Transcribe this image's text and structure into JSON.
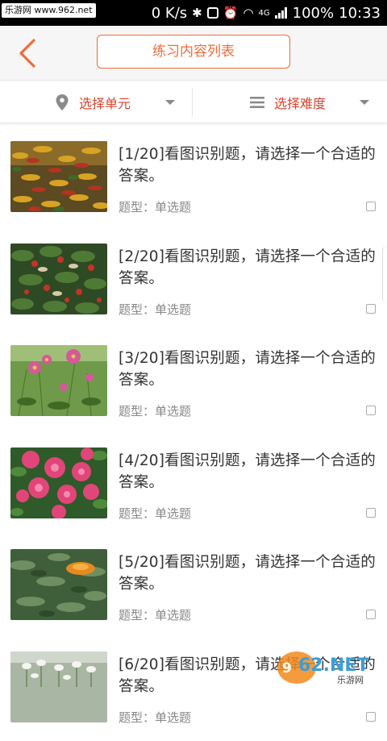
{
  "statusbar": {
    "site_watermark": "乐游网 www.962.net",
    "speed": "0 K/s",
    "network": "4G",
    "battery": "100%",
    "time": "10:33"
  },
  "header": {
    "back_icon": "chevron-left-icon",
    "title": "练习内容列表"
  },
  "filters": [
    {
      "icon": "location-pin-icon",
      "label": "选择单元"
    },
    {
      "icon": "list-icon",
      "label": "选择难度"
    }
  ],
  "colors": {
    "accent": "#f26b3a",
    "filter_text": "#d9442f"
  },
  "questions": [
    {
      "title": "[1/20]看图识别题，请选择一个合适的答案。",
      "type": "题型：单选题",
      "checked": false,
      "image": "red-yellow-leaf-plants"
    },
    {
      "title": "[2/20]看图识别题，请选择一个合适的答案。",
      "type": "题型：单选题",
      "checked": false,
      "image": "green-shrub-red-flowers"
    },
    {
      "title": "[3/20]看图识别题，请选择一个合适的答案。",
      "type": "题型：单选题",
      "checked": false,
      "image": "pink-cosmos-flowers"
    },
    {
      "title": "[4/20]看图识别题，请选择一个合适的答案。",
      "type": "题型：单选题",
      "checked": false,
      "image": "pink-azalea-flowers"
    },
    {
      "title": "[5/20]看图识别题，请选择一个合适的答案。",
      "type": "题型：单选题",
      "checked": false,
      "image": "orange-marigold"
    },
    {
      "title": "[6/20]看图识别题，请选择一个合适的答案。",
      "type": "题型：单选题",
      "checked": false,
      "image": "white-lilies"
    }
  ],
  "watermark_logo": {
    "text": "962.NET",
    "subtext": "乐游网"
  }
}
